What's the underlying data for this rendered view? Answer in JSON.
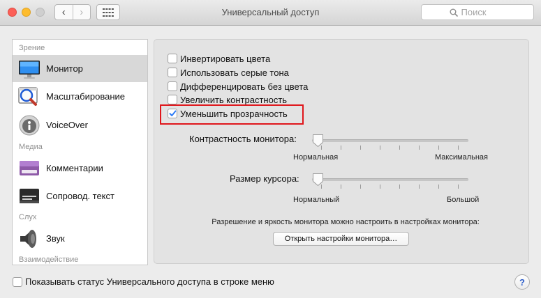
{
  "window": {
    "title": "Универсальный доступ"
  },
  "toolbar": {
    "back_label": "‹",
    "forward_label": "›"
  },
  "search": {
    "placeholder": "Поиск"
  },
  "sidebar": {
    "sections": [
      {
        "header": "Зрение",
        "items": [
          {
            "label": "Монитор",
            "icon": "monitor-icon",
            "selected": true
          },
          {
            "label": "Масштабирование",
            "icon": "magnifier-icon"
          },
          {
            "label": "VoiceOver",
            "icon": "voiceover-icon"
          }
        ]
      },
      {
        "header": "Медиа",
        "items": [
          {
            "label": "Комментарии",
            "icon": "comments-icon"
          },
          {
            "label": "Сопровод. текст",
            "icon": "captions-icon"
          }
        ]
      },
      {
        "header": "Слух",
        "items": [
          {
            "label": "Звук",
            "icon": "speaker-icon"
          }
        ]
      },
      {
        "header": "Взаимодействие",
        "items": []
      }
    ]
  },
  "display": {
    "options": [
      {
        "label": "Инвертировать цвета",
        "checked": false
      },
      {
        "label": "Использовать серые тона",
        "checked": false
      },
      {
        "label": "Дифференцировать без цвета",
        "checked": false
      },
      {
        "label": "Увеличить контрастность",
        "checked": false
      },
      {
        "label": "Уменьшить прозрачность",
        "checked": true
      }
    ],
    "contrast": {
      "label": "Контрастность монитора:",
      "min_label": "Нормальная",
      "max_label": "Максимальная",
      "value": 0
    },
    "cursor": {
      "label": "Размер курсора:",
      "min_label": "Нормальный",
      "max_label": "Большой",
      "value": 0
    },
    "info_text": "Разрешение и яркость монитора можно настроить в настройках монитора:",
    "open_button": "Открыть настройки монитора…"
  },
  "footer": {
    "show_status_label": "Показывать статус Универсального доступа в строке меню",
    "show_status_checked": false,
    "help_label": "?"
  },
  "colors": {
    "accent": "#2f7cf6",
    "highlight": "#e0161b"
  }
}
